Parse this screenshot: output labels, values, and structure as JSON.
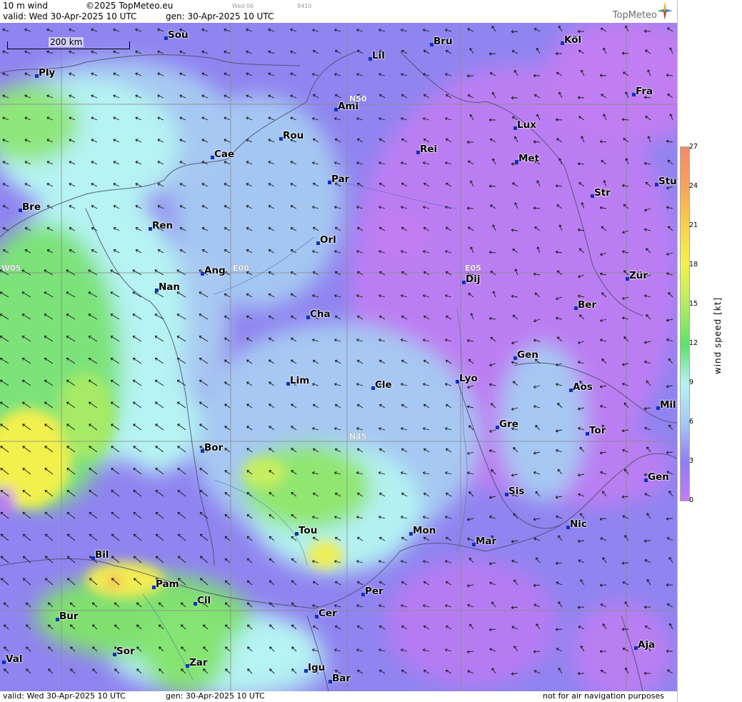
{
  "header": {
    "product": "10 m wind",
    "copyright": "©2025 TopMeteo.eu",
    "run_day": "Wed 06",
    "code": "9410",
    "valid": "valid:  Wed  30-Apr-2025  10 UTC",
    "generated": "gen: 30-Apr-2025 10 UTC",
    "brand": "TopMeteo"
  },
  "footer": {
    "valid": "valid:  Wed  30-Apr-2025  10 UTC",
    "generated": "gen: 30-Apr-2025 10 UTC",
    "disclaimer": "not for air navigation purposes"
  },
  "scale": {
    "label": "200 km"
  },
  "grid_labels": {
    "n50": "N50",
    "n45": "N45",
    "w05": "W05",
    "e00": "E00",
    "e05": "E05"
  },
  "legend": {
    "title": "wind speed [kt]",
    "ticks": [
      "27",
      "24",
      "21",
      "18",
      "15",
      "12",
      "9",
      "6",
      "3",
      "0"
    ],
    "colors": [
      "#f08a6a",
      "#f7a25f",
      "#fbd04e",
      "#f4f14e",
      "#b8ec63",
      "#5ee06c",
      "#b6f3f3",
      "#a6c8f2",
      "#8f7ef0",
      "#c27df2"
    ]
  },
  "cities": [
    {
      "name": "Sou"
    },
    {
      "name": "Bru"
    },
    {
      "name": "Köl"
    },
    {
      "name": "Ply"
    },
    {
      "name": "Lil"
    },
    {
      "name": "Fra"
    },
    {
      "name": "Ami"
    },
    {
      "name": "Lux"
    },
    {
      "name": "Rou"
    },
    {
      "name": "Cae"
    },
    {
      "name": "Rei"
    },
    {
      "name": "Met"
    },
    {
      "name": "Par"
    },
    {
      "name": "Stu"
    },
    {
      "name": "Str"
    },
    {
      "name": "Bre"
    },
    {
      "name": "Ren"
    },
    {
      "name": "Orl"
    },
    {
      "name": "Ang"
    },
    {
      "name": "Nan"
    },
    {
      "name": "Dij"
    },
    {
      "name": "Zür"
    },
    {
      "name": "Ber"
    },
    {
      "name": "Cha"
    },
    {
      "name": "Gen"
    },
    {
      "name": "Lim"
    },
    {
      "name": "Cle"
    },
    {
      "name": "Lyo"
    },
    {
      "name": "Aos"
    },
    {
      "name": "Mil"
    },
    {
      "name": "Gre"
    },
    {
      "name": "Tor"
    },
    {
      "name": "Bor"
    },
    {
      "name": "Gen"
    },
    {
      "name": "Sis"
    },
    {
      "name": "Nic"
    },
    {
      "name": "Tou"
    },
    {
      "name": "Mon"
    },
    {
      "name": "Mar"
    },
    {
      "name": "Bil"
    },
    {
      "name": "Pam"
    },
    {
      "name": "Cil"
    },
    {
      "name": "Per"
    },
    {
      "name": "Cer"
    },
    {
      "name": "Bur"
    },
    {
      "name": "Sor"
    },
    {
      "name": "Zar"
    },
    {
      "name": "Aja"
    },
    {
      "name": "Val"
    },
    {
      "name": "Igu"
    },
    {
      "name": "Bar"
    }
  ]
}
